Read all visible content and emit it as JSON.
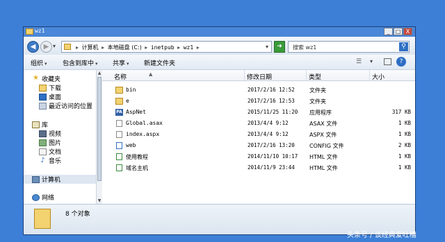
{
  "window": {
    "title": "wz1"
  },
  "title_buttons": {
    "minimize": "_",
    "maximize": "□",
    "close": "X"
  },
  "address": {
    "crumbs": [
      "计算机",
      "本地磁盘 (C:)",
      "inetpub",
      "wz1"
    ],
    "separator": "▸"
  },
  "search": {
    "placeholder": "搜索 wz1"
  },
  "toolbar": {
    "organize": "组织",
    "include_in_library": "包含到库中",
    "share": "共享",
    "new_folder": "新建文件夹"
  },
  "sidebar": {
    "favorites": {
      "label": "收藏夹",
      "items": [
        "下载",
        "桌面",
        "最近访问的位置"
      ]
    },
    "libraries": {
      "label": "库",
      "items": [
        "视频",
        "图片",
        "文档",
        "音乐"
      ]
    },
    "computer": "计算机",
    "network": "网络"
  },
  "columns": {
    "name": "名称",
    "date": "修改日期",
    "type": "类型",
    "size": "大小"
  },
  "files": [
    {
      "name": "bin",
      "date": "2017/2/16 12:52",
      "type": "文件夹",
      "size": "",
      "icon": "folder-icon"
    },
    {
      "name": "e",
      "date": "2017/2/16 12:53",
      "type": "文件夹",
      "size": "",
      "icon": "folder-icon"
    },
    {
      "name": "AspNet",
      "date": "2015/11/25 11:20",
      "type": "应用程序",
      "size": "317 KB",
      "icon": "application-icon"
    },
    {
      "name": "Global.asax",
      "date": "2013/4/4 9:12",
      "type": "ASAX 文件",
      "size": "1 KB",
      "icon": "file-icon"
    },
    {
      "name": "index.aspx",
      "date": "2013/4/4 9:12",
      "type": "ASPX 文件",
      "size": "1 KB",
      "icon": "file-icon"
    },
    {
      "name": "web",
      "date": "2017/2/16 13:20",
      "type": "CONFIG 文件",
      "size": "2 KB",
      "icon": "config-file-icon"
    },
    {
      "name": "使用教程",
      "date": "2014/11/10 10:17",
      "type": "HTML 文件",
      "size": "1 KB",
      "icon": "html-file-icon"
    },
    {
      "name": "域名主机",
      "date": "2014/11/9 23:44",
      "type": "HTML 文件",
      "size": "1 KB",
      "icon": "html-file-icon"
    }
  ],
  "status": {
    "count_text": "8 个对象"
  },
  "watermark": "头条号 / 谈经典爱吐槽",
  "colors": {
    "desktop": "#3d7fd6",
    "titlebar": "#4a87d8",
    "folder": "#f3d270",
    "accent": "#2f6fc4"
  }
}
